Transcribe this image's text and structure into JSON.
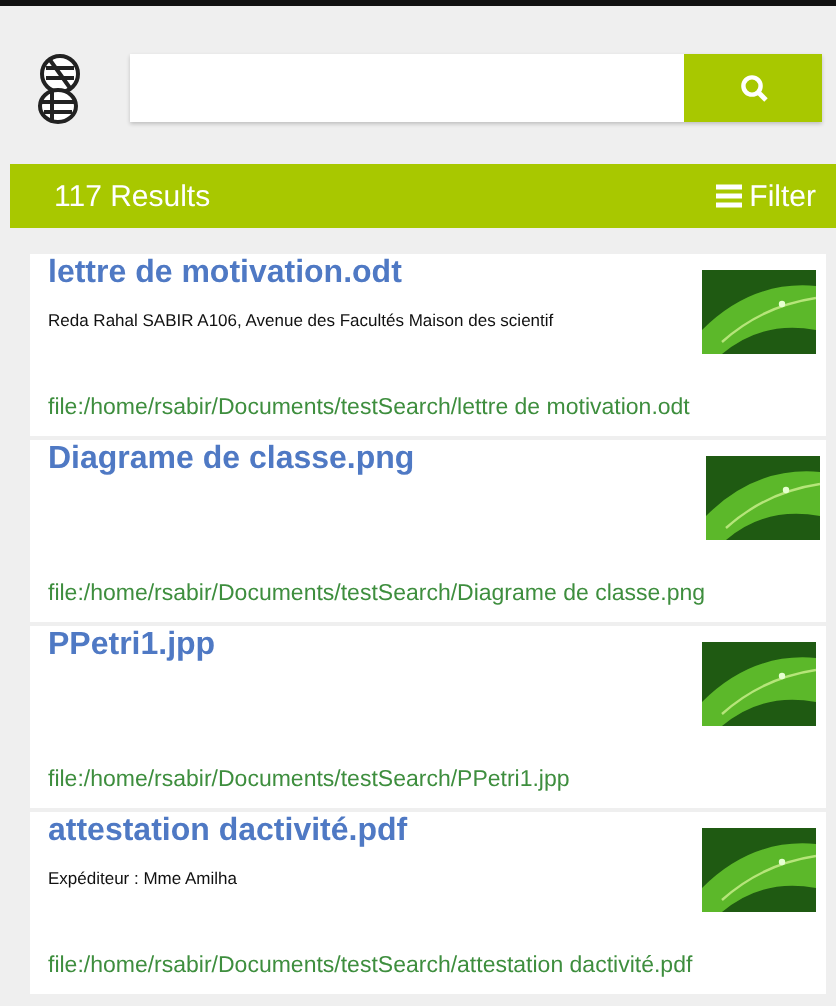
{
  "results_bar": {
    "count": "117 Results",
    "filter": "Filter"
  },
  "results": [
    {
      "title": "lettre de motivation.odt",
      "snippet": "Reda Rahal SABIR A106, Avenue des Facultés Maison des scientif",
      "path": "file:/home/rsabir/Documents/testSearch/lettre de motivation.odt"
    },
    {
      "title": "Diagrame de classe.png",
      "path": "file:/home/rsabir/Documents/testSearch/Diagrame de classe.png"
    },
    {
      "title": "PPetri1.jpp",
      "path": "file:/home/rsabir/Documents/testSearch/PPetri1.jpp"
    },
    {
      "title": "attestation dactivité.pdf",
      "snippet": "Expéditeur : Mme Amilha",
      "path": "file:/home/rsabir/Documents/testSearch/attestation dactivité.pdf"
    }
  ]
}
